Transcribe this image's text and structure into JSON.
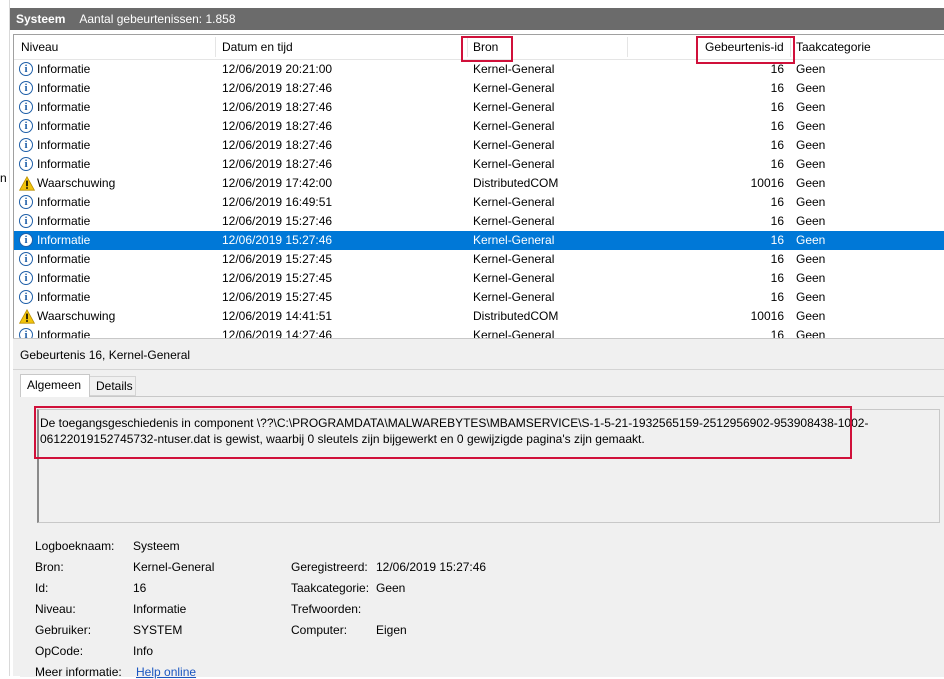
{
  "header": {
    "log_name": "Systeem",
    "event_count": "Aantal gebeurtenissen: 1.858"
  },
  "left_fragment": "n",
  "columns": {
    "level": "Niveau",
    "datetime": "Datum en tijd",
    "source": "Bron",
    "event_id": "Gebeurtenis-id",
    "category": "Taakcategorie"
  },
  "events": [
    {
      "icon": "info-icon",
      "level": "Informatie",
      "datetime": "12/06/2019 20:21:00",
      "source": "Kernel-General",
      "event_id": "16",
      "category": "Geen"
    },
    {
      "icon": "info-icon",
      "level": "Informatie",
      "datetime": "12/06/2019 18:27:46",
      "source": "Kernel-General",
      "event_id": "16",
      "category": "Geen"
    },
    {
      "icon": "info-icon",
      "level": "Informatie",
      "datetime": "12/06/2019 18:27:46",
      "source": "Kernel-General",
      "event_id": "16",
      "category": "Geen"
    },
    {
      "icon": "info-icon",
      "level": "Informatie",
      "datetime": "12/06/2019 18:27:46",
      "source": "Kernel-General",
      "event_id": "16",
      "category": "Geen"
    },
    {
      "icon": "info-icon",
      "level": "Informatie",
      "datetime": "12/06/2019 18:27:46",
      "source": "Kernel-General",
      "event_id": "16",
      "category": "Geen"
    },
    {
      "icon": "info-icon",
      "level": "Informatie",
      "datetime": "12/06/2019 18:27:46",
      "source": "Kernel-General",
      "event_id": "16",
      "category": "Geen"
    },
    {
      "icon": "warning-icon",
      "level": "Waarschuwing",
      "datetime": "12/06/2019 17:42:00",
      "source": "DistributedCOM",
      "event_id": "10016",
      "category": "Geen"
    },
    {
      "icon": "info-icon",
      "level": "Informatie",
      "datetime": "12/06/2019 16:49:51",
      "source": "Kernel-General",
      "event_id": "16",
      "category": "Geen"
    },
    {
      "icon": "info-icon",
      "level": "Informatie",
      "datetime": "12/06/2019 15:27:46",
      "source": "Kernel-General",
      "event_id": "16",
      "category": "Geen"
    },
    {
      "icon": "info-icon",
      "level": "Informatie",
      "datetime": "12/06/2019 15:27:46",
      "source": "Kernel-General",
      "event_id": "16",
      "category": "Geen",
      "selected": true
    },
    {
      "icon": "info-icon",
      "level": "Informatie",
      "datetime": "12/06/2019 15:27:45",
      "source": "Kernel-General",
      "event_id": "16",
      "category": "Geen"
    },
    {
      "icon": "info-icon",
      "level": "Informatie",
      "datetime": "12/06/2019 15:27:45",
      "source": "Kernel-General",
      "event_id": "16",
      "category": "Geen"
    },
    {
      "icon": "info-icon",
      "level": "Informatie",
      "datetime": "12/06/2019 15:27:45",
      "source": "Kernel-General",
      "event_id": "16",
      "category": "Geen"
    },
    {
      "icon": "warning-icon",
      "level": "Waarschuwing",
      "datetime": "12/06/2019 14:41:51",
      "source": "DistributedCOM",
      "event_id": "10016",
      "category": "Geen"
    },
    {
      "icon": "info-icon",
      "level": "Informatie",
      "datetime": "12/06/2019 14:27:46",
      "source": "Kernel-General",
      "event_id": "16",
      "category": "Geen"
    }
  ],
  "detail": {
    "title": "Gebeurtenis 16, Kernel-General",
    "tabs": {
      "general": "Algemeen",
      "details": "Details"
    },
    "message": "De toegangsgeschiedenis in component \\??\\C:\\PROGRAMDATA\\MALWAREBYTES\\MBAMSERVICE\\S-1-5-21-1932565159-2512956902-953908438-1002-06122019152745732-ntuser.dat is gewist, waarbij 0 sleutels zijn bijgewerkt en 0 gewijzigde pagina's zijn gemaakt.",
    "fields": {
      "log_name_label": "Logboeknaam:",
      "log_name": "Systeem",
      "source_label": "Bron:",
      "source": "Kernel-General",
      "id_label": "Id:",
      "id": "16",
      "level_label": "Niveau:",
      "level": "Informatie",
      "user_label": "Gebruiker:",
      "user": "SYSTEM",
      "opcode_label": "OpCode:",
      "opcode": "Info",
      "more_info_label": "Meer informatie:",
      "more_info_link": "Help online",
      "logged_label": "Geregistreerd:",
      "logged": "12/06/2019 15:27:46",
      "task_category_label": "Taakcategorie:",
      "task_category": "Geen",
      "keywords_label": "Trefwoorden:",
      "keywords": "",
      "computer_label": "Computer:",
      "computer": "Eigen"
    }
  },
  "colors": {
    "highlight_box": "#d0103a",
    "selection": "#0078d7",
    "titlebar": "#6b6b6b"
  }
}
